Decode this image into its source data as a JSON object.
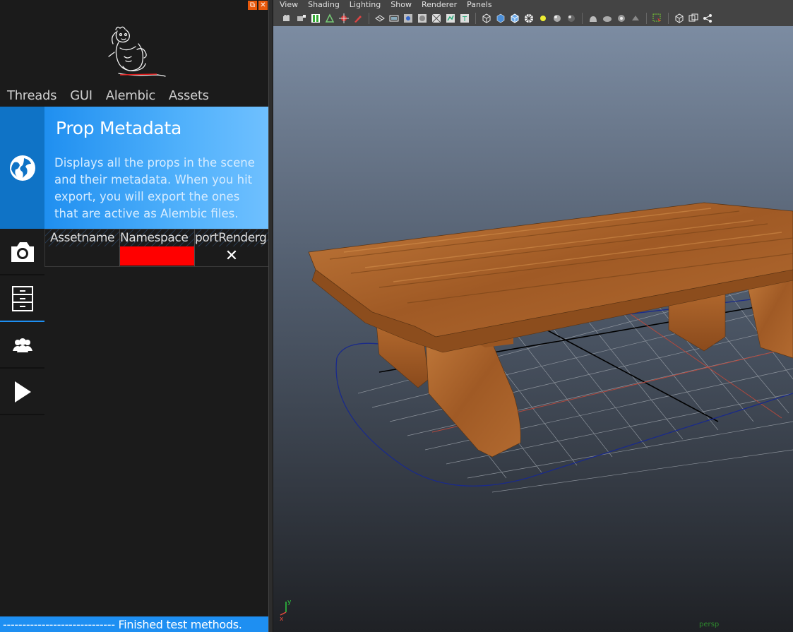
{
  "panel": {
    "nav": [
      "Threads",
      "GUI",
      "Alembic",
      "Assets"
    ],
    "header": {
      "title": "Prop Metadata",
      "description": "Displays all the props in the scene and their metadata. When you hit export, you will export the ones that are active as Alembic files."
    },
    "side_icons": [
      "globe-icon",
      "camera-icon",
      "cabinet-icon",
      "users-icon",
      "play-icon"
    ],
    "progress": "0%",
    "table": {
      "columns": [
        "Assetname",
        "Namespace",
        "portRenderg"
      ],
      "row": {
        "assetname": "",
        "namespace": "",
        "export_mark": "✕"
      },
      "namespace_color": "#ff0000"
    },
    "status": "----------------------------- Finished test methods."
  },
  "maya": {
    "menus": [
      "View",
      "Shading",
      "Lighting",
      "Show",
      "Renderer",
      "Panels"
    ],
    "camera_label": "persp",
    "axis": {
      "x": "x",
      "y": "y"
    }
  },
  "colors": {
    "accent": "#1e8ff2",
    "header_gradient_end": "#6fc0ff",
    "panel_bg": "#1b1b1b",
    "status_red": "#ff0000"
  }
}
